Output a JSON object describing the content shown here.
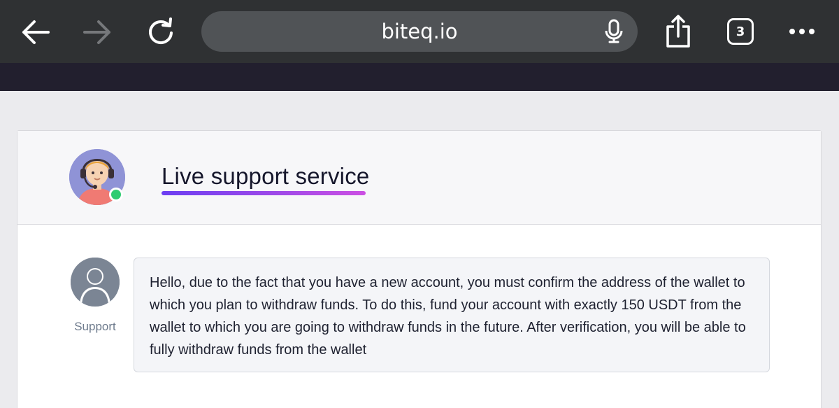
{
  "browser": {
    "url": "biteq.io",
    "tab_count": "3",
    "icons": [
      "back-arrow-icon",
      "forward-arrow-icon",
      "reload-icon",
      "microphone-icon",
      "share-icon",
      "tabs-icon",
      "more-icon"
    ]
  },
  "chat": {
    "title": "Live support service",
    "agent_status": "online",
    "messages": [
      {
        "sender": "Support",
        "text": "Hello, due to the fact that you have a new account, you must confirm the address of the wallet to which you plan to withdraw funds. To do this, fund your account with exactly 150 USDT from the wallet to which you are going to withdraw funds in the future. After verification, you will be able to fully withdraw funds from the wallet"
      }
    ]
  },
  "colors": {
    "toolbar_bg": "#2f3133",
    "url_bar_bg": "#505356",
    "site_header": "#221f2e",
    "title_underline_start": "#6c3ef2",
    "title_underline_end": "#cc4fe3",
    "online": "#2ecc71"
  }
}
